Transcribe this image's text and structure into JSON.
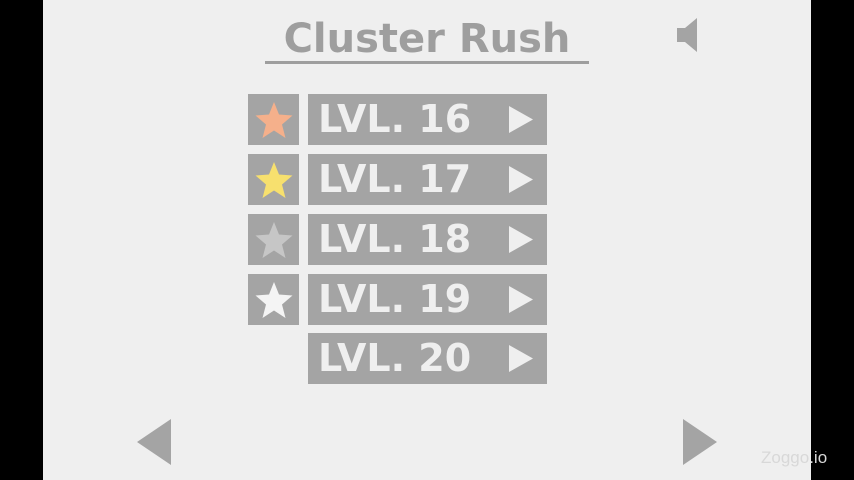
{
  "title": "Cluster Rush",
  "icons": {
    "sound": "speaker-icon",
    "play": "play-icon",
    "prev": "arrow-left-icon",
    "next": "arrow-right-icon",
    "star": "star-icon"
  },
  "colors": {
    "panel": "#a4a4a4",
    "background": "#efefef",
    "star_bronze": "#f5b08b",
    "star_gold": "#f7e06e",
    "star_silver": "#c6c6c6",
    "star_empty": "#f4f4f4"
  },
  "levels": [
    {
      "label": "LVL. 16",
      "star": "bronze"
    },
    {
      "label": "LVL. 17",
      "star": "gold"
    },
    {
      "label": "LVL. 18",
      "star": "silver"
    },
    {
      "label": "LVL. 19",
      "star": "empty"
    },
    {
      "label": "LVL. 20",
      "star": "none"
    }
  ],
  "watermark": "Zoggo.io"
}
